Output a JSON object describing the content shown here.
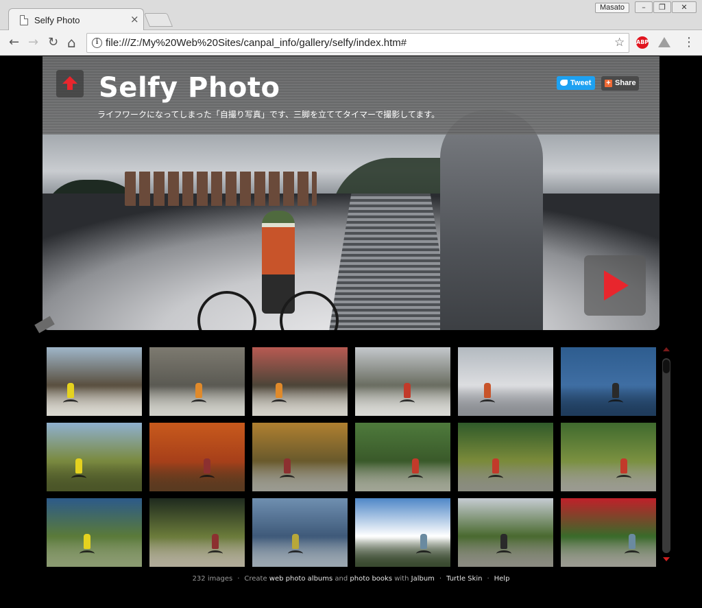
{
  "browser": {
    "tab_title": "Selfy Photo",
    "tab_close": "×",
    "user_badge": "Masato",
    "win_min": "–",
    "win_max": "❐",
    "win_close": "✕",
    "url": "file:///Z:/My%20Web%20Sites/canpal_info/gallery/selfy/index.htm#",
    "back_icon": "←",
    "forward_icon": "→",
    "reload_icon": "↻",
    "home_icon": "⌂",
    "info_icon": "i",
    "star_icon": "☆",
    "adblock_label": "ABP",
    "menu_icon": "⋮"
  },
  "header": {
    "title": "Selfy Photo",
    "subtitle": "ライフワークになってしまった「自撮り写真」です、三脚を立ててタイマーで撮影してます。",
    "tweet_label": "Tweet",
    "share_label": "Share",
    "share_plus": "+"
  },
  "colors": {
    "accent_red": "#e8262d",
    "tweet_blue": "#1da1f2",
    "share_orange": "#f06a35"
  },
  "thumbnails": [
    {
      "palette": [
        "#9fb6c9",
        "#5a5040",
        "#d9d7cf"
      ],
      "rider": "#e5d21f"
    },
    {
      "palette": [
        "#7d7a70",
        "#5b5a53",
        "#cfcfc8"
      ],
      "rider": "#e08a2b"
    },
    {
      "palette": [
        "#b85a52",
        "#4d4538",
        "#d2d0c8"
      ],
      "rider": "#e08a2b"
    },
    {
      "palette": [
        "#c4c8cc",
        "#6b6e62",
        "#d8d8d4"
      ],
      "rider": "#c23a2a"
    },
    {
      "palette": [
        "#b3bac0",
        "#dcdde0",
        "#8a8d92"
      ],
      "rider": "#c8542a"
    },
    {
      "palette": [
        "#2e5d8f",
        "#3f6ea3",
        "#1f3c5c"
      ],
      "rider": "#2a2a2a"
    },
    {
      "palette": [
        "#8fb0cf",
        "#7a8a40",
        "#4b5528"
      ],
      "rider": "#e5d21f"
    },
    {
      "palette": [
        "#c85a1c",
        "#a8401a",
        "#5a3a20"
      ],
      "rider": "#8c3030"
    },
    {
      "palette": [
        "#b08030",
        "#6a5a2c",
        "#9a9a90"
      ],
      "rider": "#8c3030"
    },
    {
      "palette": [
        "#4e7a3c",
        "#3a5a2a",
        "#a0a494"
      ],
      "rider": "#c23a2a"
    },
    {
      "palette": [
        "#2f5a2a",
        "#7a8a3a",
        "#8a8c80"
      ],
      "rider": "#c23a2a"
    },
    {
      "palette": [
        "#3f6a2e",
        "#7a9040",
        "#9a9a90"
      ],
      "rider": "#c23a2a"
    },
    {
      "palette": [
        "#2c5a8a",
        "#5a7a3a",
        "#8a9a70"
      ],
      "rider": "#e5d21f"
    },
    {
      "palette": [
        "#1e2a1e",
        "#6a7a3a",
        "#b0ab98"
      ],
      "rider": "#8c3030"
    },
    {
      "palette": [
        "#6f8fb0",
        "#3f5a7a",
        "#9aa6b0"
      ],
      "rider": "#b8a83a"
    },
    {
      "palette": [
        "#4f87c7",
        "#ffffff",
        "#3a4a30"
      ],
      "rider": "#6a8aa0"
    },
    {
      "palette": [
        "#c6ccd2",
        "#4a6a30",
        "#8a8a80"
      ],
      "rider": "#2a2a2a"
    },
    {
      "palette": [
        "#c0202a",
        "#3a6a2a",
        "#9a9a90"
      ],
      "rider": "#6a8aa0"
    }
  ],
  "footer": {
    "count": "232 images",
    "create": "Create",
    "web_albums": "web photo albums",
    "and": "and",
    "photo_books": "photo books",
    "with": "with",
    "jalbum": "Jalbum",
    "skin": "Turtle Skin",
    "help": "Help",
    "sep": "·"
  }
}
